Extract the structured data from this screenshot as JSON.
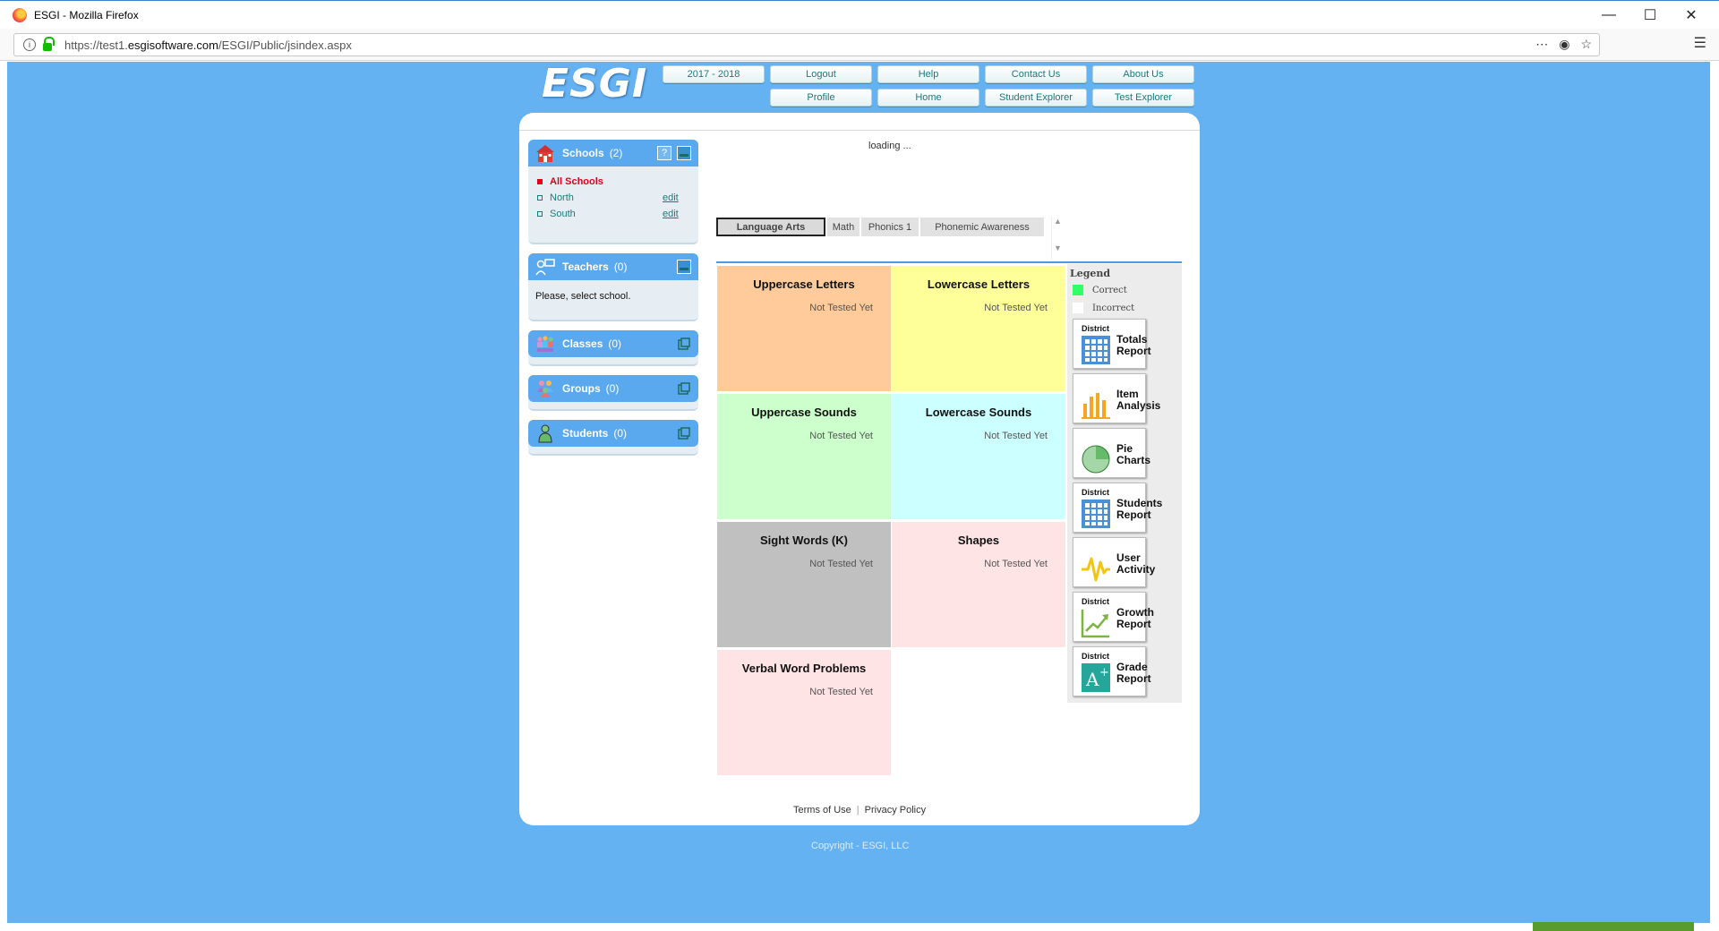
{
  "browser": {
    "window_title": "ESGI - Mozilla Firefox",
    "url_prefix": "https://test1.",
    "url_domain": "esgisoftware.com",
    "url_path": "/ESGI/Public/jsindex.aspx"
  },
  "header": {
    "logo": "ESGI",
    "nav_row1": [
      "2017 - 2018",
      "Logout",
      "Help",
      "Contact Us",
      "About Us"
    ],
    "nav_row2": [
      "Profile",
      "Home",
      "Student Explorer",
      "Test Explorer"
    ]
  },
  "sidebar": {
    "schools": {
      "title": "Schools",
      "count": "(2)",
      "help": "?",
      "all": "All Schools",
      "items": [
        {
          "name": "North",
          "edit": "edit"
        },
        {
          "name": "South",
          "edit": "edit"
        }
      ]
    },
    "teachers": {
      "title": "Teachers",
      "count": "(0)",
      "message": "Please, select school."
    },
    "classes": {
      "title": "Classes",
      "count": "(0)"
    },
    "groups": {
      "title": "Groups",
      "count": "(0)"
    },
    "students": {
      "title": "Students",
      "count": "(0)"
    }
  },
  "main": {
    "loading": "loading ...",
    "tabs": [
      "Language Arts",
      "Math",
      "Phonics 1",
      "Phonemic Awareness"
    ],
    "tiles": [
      {
        "name": "Uppercase Letters",
        "status": "Not Tested Yet",
        "color": "#ffcb9a"
      },
      {
        "name": "Lowercase Letters",
        "status": "Not Tested Yet",
        "color": "#ffff99"
      },
      {
        "name": "Uppercase Sounds",
        "status": "Not Tested Yet",
        "color": "#ccffcc"
      },
      {
        "name": "Lowercase Sounds",
        "status": "Not Tested Yet",
        "color": "#ccffff"
      },
      {
        "name": "Sight Words (K)",
        "status": "Not Tested Yet",
        "color": "#c0c0c0"
      },
      {
        "name": "Shapes",
        "status": "Not Tested Yet",
        "color": "#ffe4e6"
      },
      {
        "name": "Verbal Word Problems",
        "status": "Not Tested Yet",
        "color": "#ffe4e6"
      }
    ]
  },
  "legend": {
    "title": "Legend",
    "correct": "Correct",
    "incorrect": "Incorrect",
    "correct_color": "#33ff66"
  },
  "reports": [
    {
      "district": "District",
      "line1": "Totals",
      "line2": "Report",
      "icon": "grid-icon"
    },
    {
      "district": "",
      "line1": "Item",
      "line2": "Analysis",
      "icon": "bar-chart-icon"
    },
    {
      "district": "",
      "line1": "Pie",
      "line2": "Charts",
      "icon": "pie-chart-icon"
    },
    {
      "district": "District",
      "line1": "Students",
      "line2": "Report",
      "icon": "grid-icon"
    },
    {
      "district": "",
      "line1": "User",
      "line2": "Activity",
      "icon": "activity-icon"
    },
    {
      "district": "District",
      "line1": "Growth",
      "line2": "Report",
      "icon": "growth-chart-icon"
    },
    {
      "district": "District",
      "line1": "Grade",
      "line2": "Report",
      "icon": "grade-icon"
    }
  ],
  "footer": {
    "terms": "Terms of Use",
    "separator": "|",
    "privacy": "Privacy Policy",
    "copyright": "Copyright - ESGI, LLC"
  },
  "colors": {
    "page_bg": "#65b2f3",
    "panel_head": "#5aa9ee",
    "link": "#1a7a7a",
    "selected": "#e0001b"
  }
}
